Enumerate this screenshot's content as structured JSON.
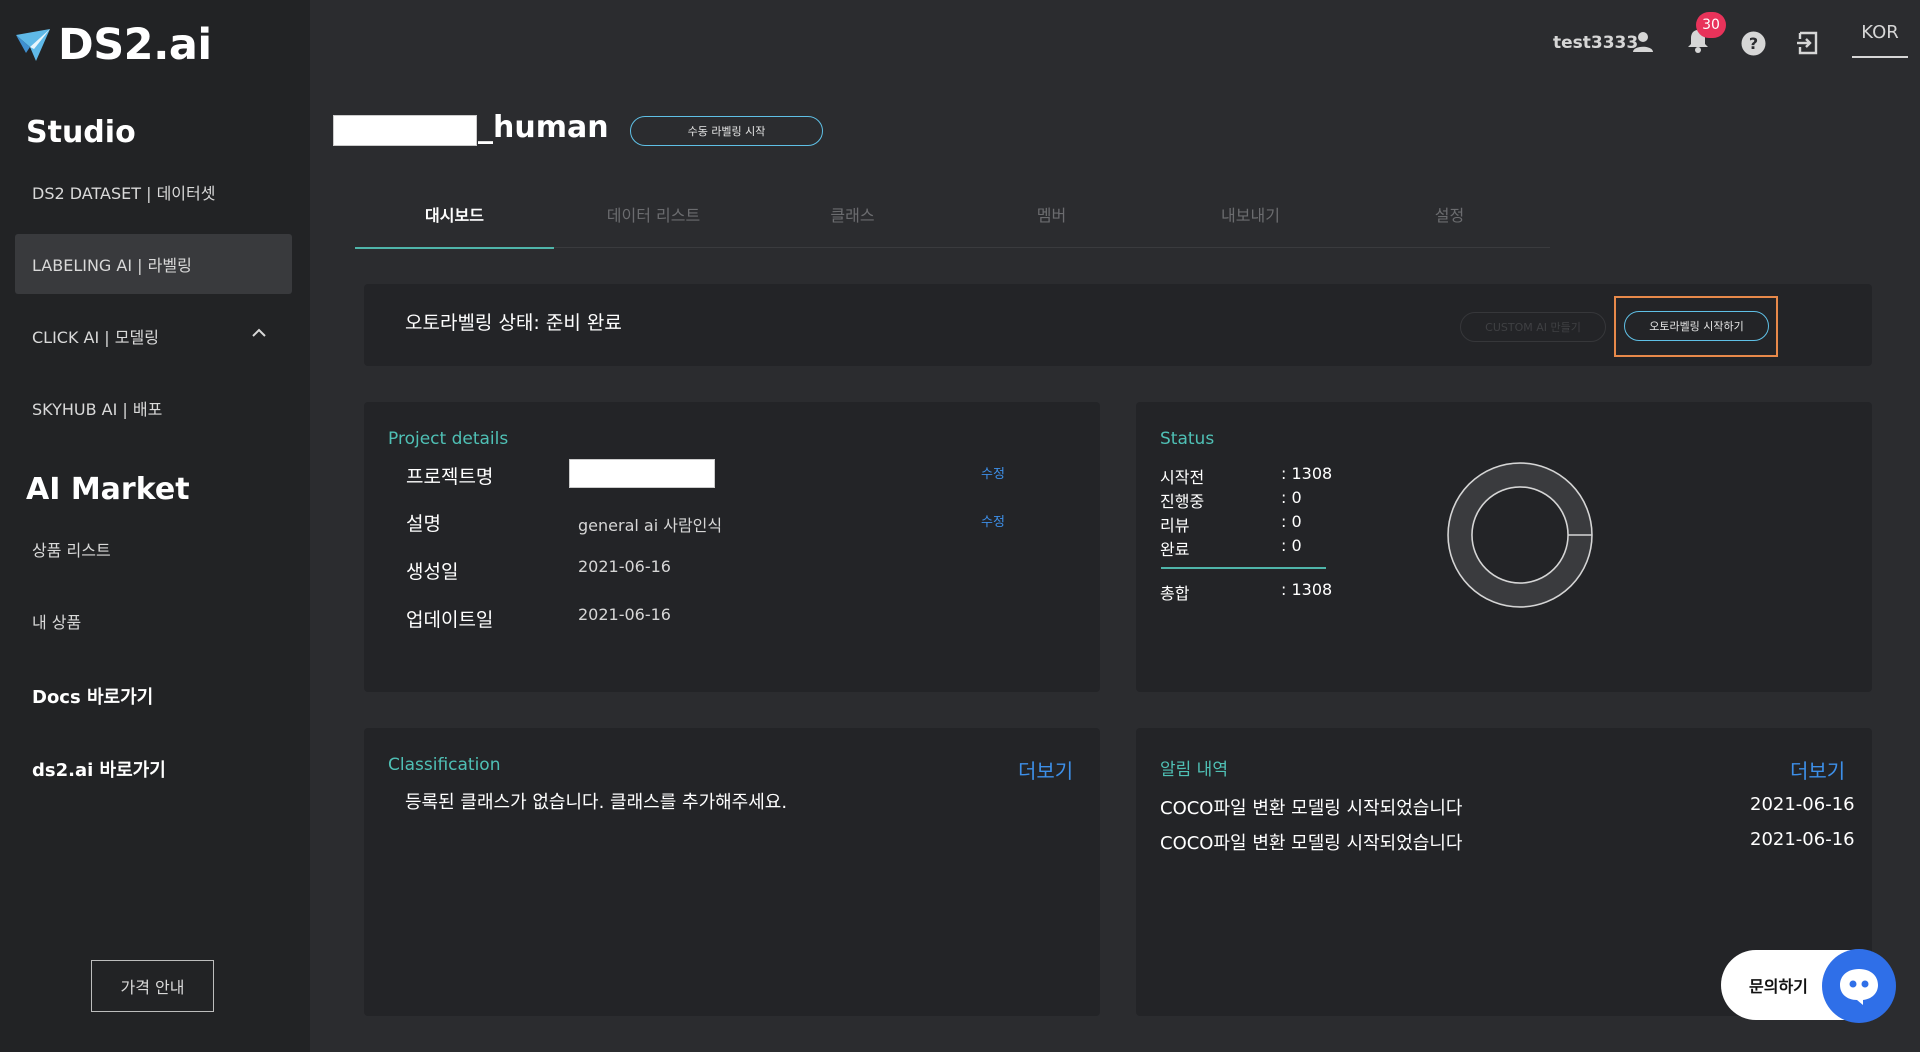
{
  "brand": {
    "name": "DS2.ai"
  },
  "sidebar": {
    "studio_title": "Studio",
    "studio_items": [
      {
        "label": "DS2 DATASET | 데이터셋"
      },
      {
        "label": "LABELING AI | 라벨링"
      },
      {
        "label": "CLICK AI | 모델링"
      },
      {
        "label": "SKYHUB AI | 배포"
      }
    ],
    "market_title": "AI Market",
    "market_items": [
      {
        "label": "상품 리스트"
      },
      {
        "label": "내 상품"
      }
    ],
    "docs_link": "Docs 바로가기",
    "site_link": "ds2.ai 바로가기",
    "price_button": "가격 안내"
  },
  "header": {
    "username": "test3333",
    "notification_count": "30",
    "language": "KOR"
  },
  "project": {
    "title_suffix": "_human",
    "manual_label_button": "수동 라벨링 시작"
  },
  "tabs": [
    {
      "label": "대시보드"
    },
    {
      "label": "데이터 리스트"
    },
    {
      "label": "클래스"
    },
    {
      "label": "멤버"
    },
    {
      "label": "내보내기"
    },
    {
      "label": "설정"
    }
  ],
  "autolabel": {
    "status_text": "오토라벨링 상태: 준비 완료",
    "custom_button": "CUSTOM AI 만들기",
    "start_button": "오토라벨링 시작하기"
  },
  "details": {
    "title": "Project details",
    "rows": [
      {
        "label": "프로젝트명",
        "value": "",
        "edit": "수정"
      },
      {
        "label": "설명",
        "value": "general ai 사람인식",
        "edit": "수정"
      },
      {
        "label": "생성일",
        "value": "2021-06-16"
      },
      {
        "label": "업데이트일",
        "value": "2021-06-16"
      }
    ]
  },
  "status": {
    "title": "Status",
    "rows": [
      {
        "label": "시작전",
        "value": ": 1308"
      },
      {
        "label": "진행중",
        "value": ": 0"
      },
      {
        "label": "리뷰",
        "value": ": 0"
      },
      {
        "label": "완료",
        "value": ": 0"
      }
    ],
    "total_label": "총합",
    "total_value": ": 1308",
    "donut_fraction": 1.0
  },
  "classification": {
    "title": "Classification",
    "more": "더보기",
    "empty_text": "등록된 클래스가 없습니다. 클래스를 추가해주세요."
  },
  "notifications": {
    "title": "알림 내역",
    "more": "더보기",
    "items": [
      {
        "text": "COCO파일 변환 모델링 시작되었습니다",
        "date": "2021-06-16"
      },
      {
        "text": "COCO파일 변환 모델링 시작되었습니다",
        "date": "2021-06-16"
      }
    ]
  },
  "inquiry": {
    "label": "문의하기"
  },
  "colors": {
    "accent_teal": "#4fb5aa",
    "link_blue": "#3d8fe8",
    "badge_red": "#e8335a",
    "highlight_orange": "#e7894a"
  }
}
